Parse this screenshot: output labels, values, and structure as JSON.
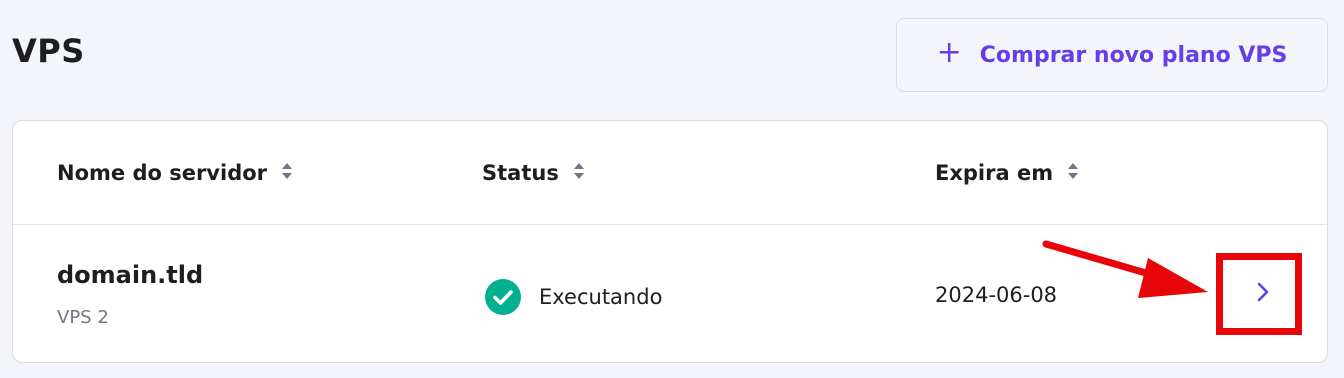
{
  "header": {
    "title": "VPS",
    "buy_button": {
      "icon": "plus-icon",
      "label": "Comprar novo plano VPS"
    }
  },
  "table": {
    "columns": [
      {
        "label": "Nome do servidor",
        "sort_icon": "sort-icon"
      },
      {
        "label": "Status",
        "sort_icon": "sort-icon"
      },
      {
        "label": "Expira em",
        "sort_icon": "sort-icon"
      }
    ],
    "rows": [
      {
        "server_name": "domain.tld",
        "plan": "VPS 2",
        "status": "Executando",
        "status_icon": "check-circle-icon",
        "expires": "2024-06-08",
        "action_icon": "chevron-right-icon"
      }
    ]
  },
  "annotation": {
    "color": "#e8050a",
    "type": "arrow-and-box"
  },
  "colors": {
    "accent": "#673de6",
    "success": "#00b090",
    "background": "#f4f4fb",
    "text": "#1d1e20",
    "muted": "#727586",
    "annotation": "#e8050a"
  }
}
